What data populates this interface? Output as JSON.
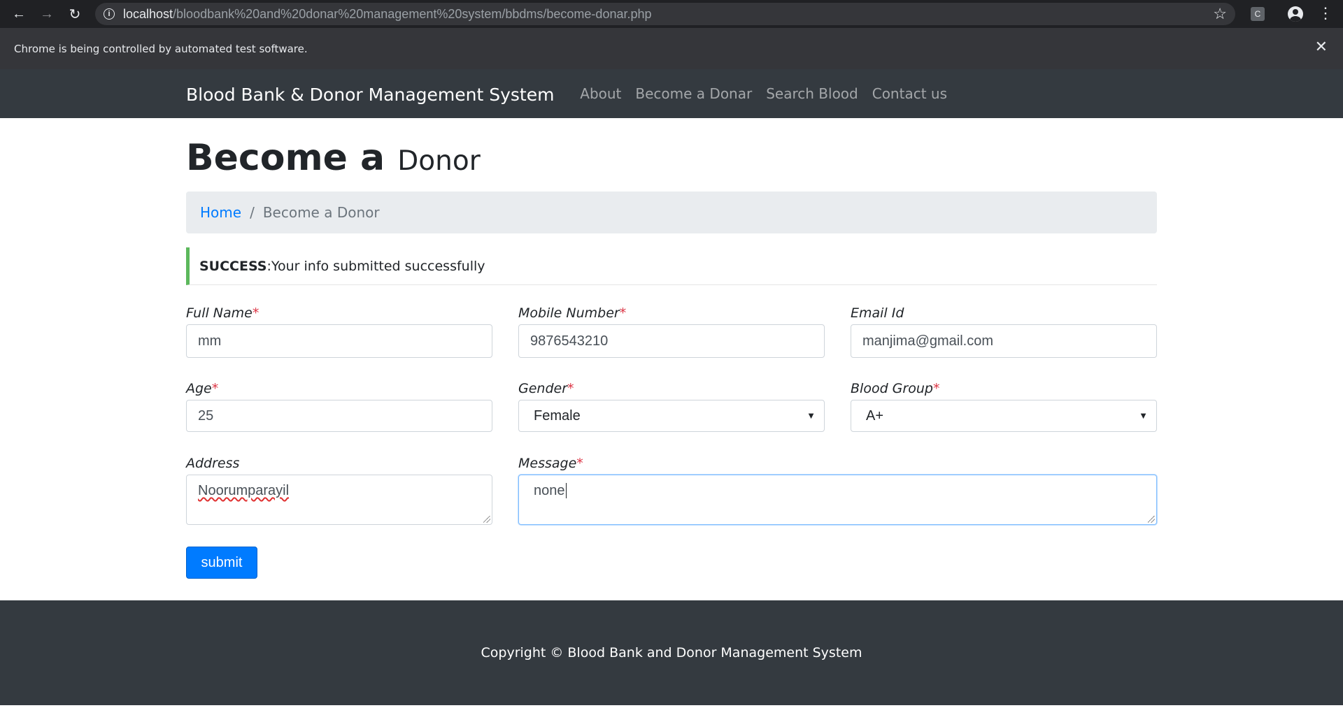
{
  "browser": {
    "url_host": "localhost",
    "url_path": "/bloodbank%20and%20donar%20management%20system/bbdms/become-donar.php",
    "extension_label": "C",
    "automation_notice": "Chrome is being controlled by automated test software."
  },
  "navbar": {
    "brand": "Blood Bank & Donor Management System",
    "links": [
      "About",
      "Become a Donar",
      "Search Blood",
      "Contact us"
    ]
  },
  "page": {
    "title_main": "Become a",
    "title_small": "Donor"
  },
  "breadcrumb": {
    "home": "Home",
    "separator": "/",
    "current": "Become a Donor"
  },
  "alert": {
    "strong": "SUCCESS",
    "message": ":Your info submitted successfully",
    "accent_color": "#5cb85c"
  },
  "form": {
    "required_mark": "*",
    "full_name": {
      "label": "Full Name",
      "value": "mm"
    },
    "mobile": {
      "label": "Mobile Number",
      "value": "9876543210"
    },
    "email": {
      "label": "Email Id",
      "value": "manjima@gmail.com"
    },
    "age": {
      "label": "Age",
      "value": "25"
    },
    "gender": {
      "label": "Gender",
      "value": "Female"
    },
    "blood_group": {
      "label": "Blood Group",
      "value": "A+"
    },
    "address": {
      "label": "Address",
      "value": "Noorumparayil"
    },
    "message": {
      "label": "Message",
      "value": "none"
    },
    "submit_label": "submit"
  },
  "footer": {
    "copyright": "Copyright © Blood Bank and Donor Management System"
  },
  "colors": {
    "primary": "#007bff",
    "navbar_bg": "#343a40",
    "required": "#dc3545"
  }
}
